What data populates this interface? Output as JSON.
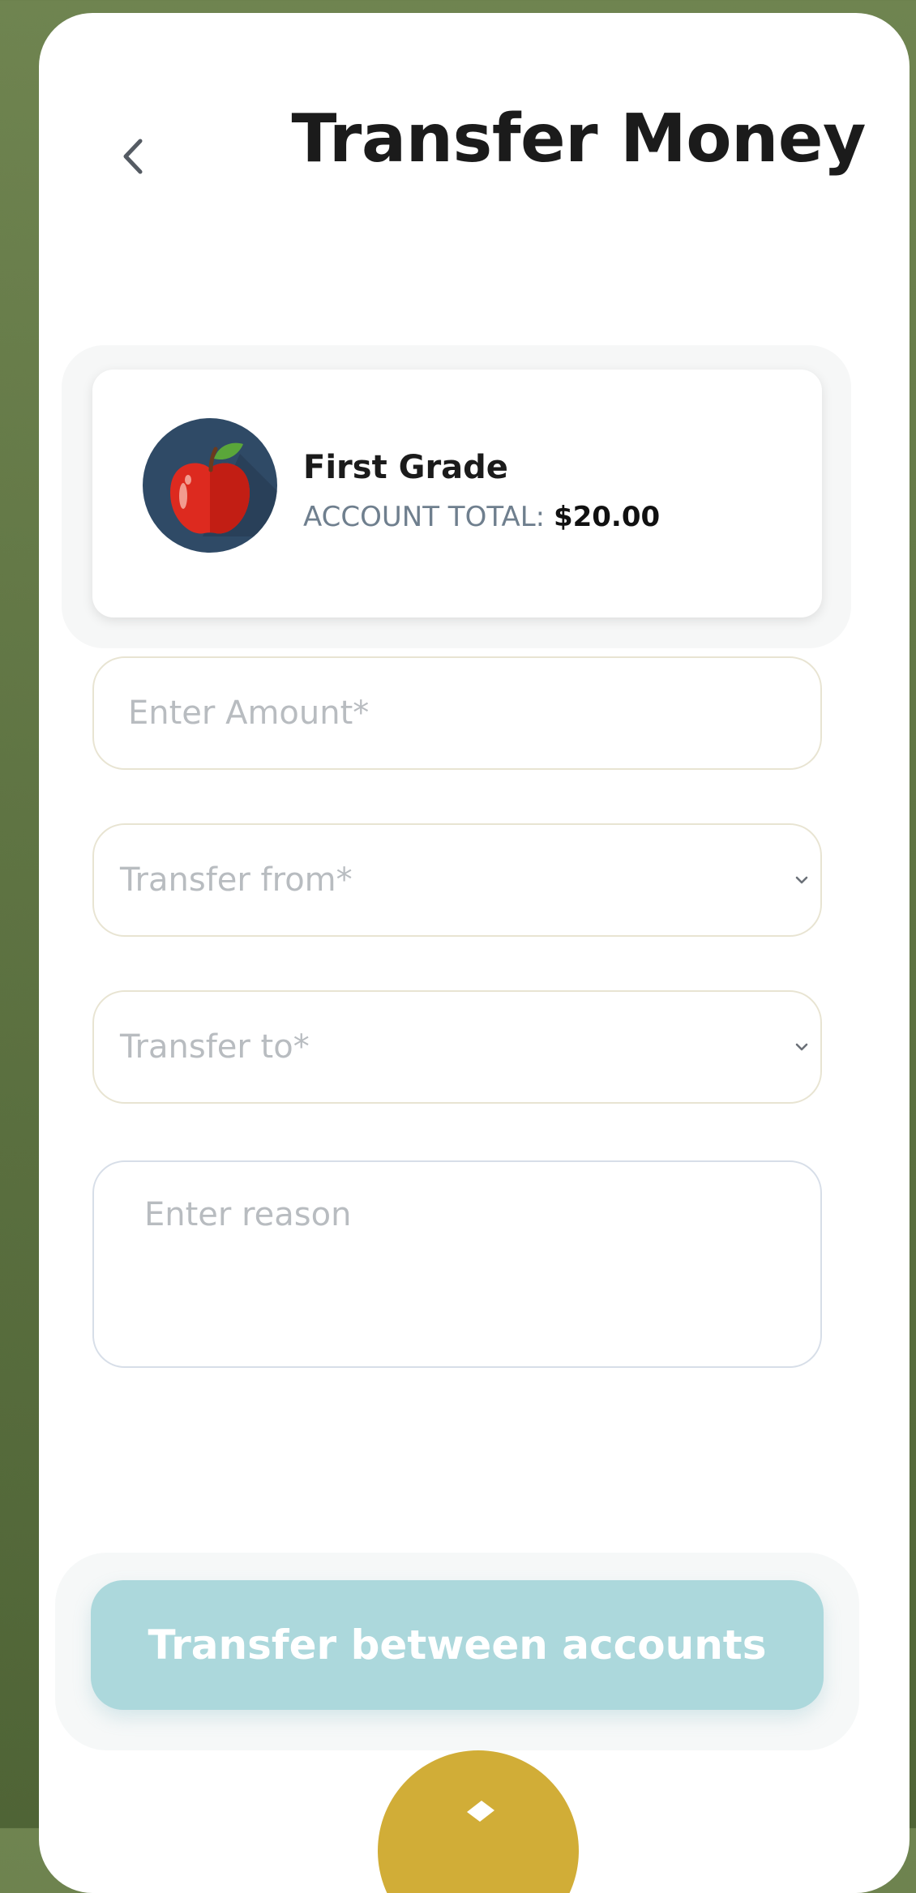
{
  "header": {
    "title": "Transfer Money",
    "back_icon": "chevron-left-icon"
  },
  "account": {
    "name": "First Grade",
    "total_label": "ACCOUNT TOTAL:",
    "total_value": "$20.00",
    "avatar_icon": "apple-icon",
    "avatar_bg": "#2f4a66"
  },
  "form": {
    "amount_placeholder": "Enter Amount*",
    "from_placeholder": "Transfer from*",
    "to_placeholder": "Transfer to*",
    "reason_placeholder": "Enter reason"
  },
  "submit": {
    "label": "Transfer between accounts",
    "color": "#acd8dc"
  },
  "fab": {
    "color": "#d1ad37",
    "icon": "pencil-icon"
  }
}
